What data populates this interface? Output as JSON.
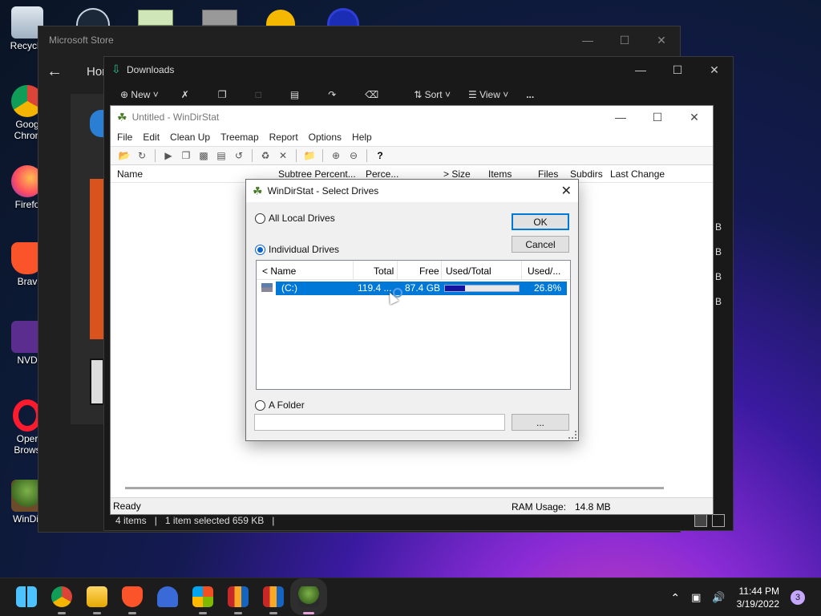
{
  "desktop": {
    "icons": [
      {
        "label": "Recycle",
        "icon": "recycle-bin-icon"
      },
      {
        "label": "Goog\nChron",
        "icon": "chrome-icon"
      },
      {
        "label": "Firefo",
        "icon": "firefox-icon"
      },
      {
        "label": "Brav",
        "icon": "brave-icon"
      },
      {
        "label": "NVD",
        "icon": "nvda-icon"
      },
      {
        "label": "Oper\nBrows",
        "icon": "opera-icon"
      },
      {
        "label": "WinDir",
        "icon": "windirstat-icon"
      }
    ]
  },
  "store": {
    "title": "Microsoft Store",
    "nav_home": "Hor"
  },
  "explorer": {
    "title": "Downloads",
    "cmd_new": "New",
    "cmd_sort": "Sort",
    "cmd_view": "View",
    "cmd_more": "...",
    "status_items": "4 items",
    "status_selected": "1 item selected  659 KB",
    "right_letters": [
      "B",
      "B",
      "B",
      "B"
    ]
  },
  "windirstat": {
    "title": "Untitled - WinDirStat",
    "menu": [
      "File",
      "Edit",
      "Clean Up",
      "Treemap",
      "Report",
      "Options",
      "Help"
    ],
    "columns": {
      "name": "Name",
      "subtree": "Subtree Percent...",
      "perce": "Perce...",
      "size": "> Size",
      "items": "Items",
      "files": "Files",
      "subdirs": "Subdirs",
      "last_change": "Last Change"
    },
    "status": {
      "ready": "Ready",
      "ram_label": "RAM Usage:",
      "ram_value": "14.8 MB"
    }
  },
  "dialog": {
    "title": "WinDirStat - Select Drives",
    "all_local": "All Local Drives",
    "individual": "Individual Drives",
    "a_folder": "A Folder",
    "ok": "OK",
    "cancel": "Cancel",
    "browse": "...",
    "list_headers": {
      "name": "< Name",
      "total": "Total",
      "free": "Free",
      "used_total": "Used/Total",
      "used_pct": "Used/..."
    },
    "drives": [
      {
        "name": "(C:)",
        "total": "119.4 ...",
        "free": "87.4 GB",
        "used_fraction": 0.268,
        "used_pct": "26.8%"
      }
    ]
  },
  "taskbar": {
    "apps": [
      "start-icon",
      "chrome-icon",
      "file-explorer-icon",
      "brave-icon",
      "nvda-icon",
      "store-icon",
      "winrar-icon",
      "winrar-icon",
      "windirstat-icon"
    ],
    "time": "11:44 PM",
    "date": "3/19/2022",
    "notification_count": "3"
  },
  "colors": {
    "selection": "#0078d7",
    "used_bar": "#1414a0"
  }
}
